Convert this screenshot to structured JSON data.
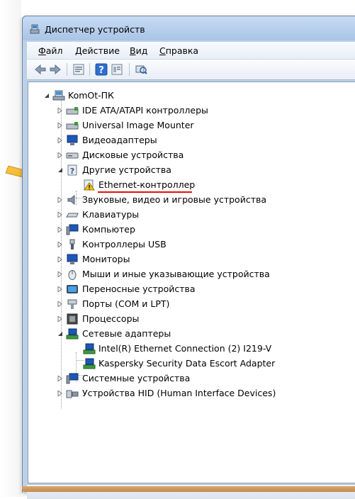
{
  "window": {
    "title": "Диспетчер устройств"
  },
  "menu": {
    "file": "Файл",
    "action": "Действие",
    "view": "Вид",
    "help": "Справка"
  },
  "toolbar": {
    "back": "back-icon",
    "forward": "forward-icon",
    "properties": "properties-icon",
    "help": "help-icon",
    "show": "show-icon",
    "scan": "scan-icon"
  },
  "tree": {
    "root": "KomOt-ПК",
    "items": [
      {
        "label": "IDE ATA/ATAPI контроллеры"
      },
      {
        "label": "Universal Image Mounter"
      },
      {
        "label": "Видеоадаптеры"
      },
      {
        "label": "Дисковые устройства"
      },
      {
        "label": "Другие устройства"
      },
      {
        "label": "Ethernet-контроллер"
      },
      {
        "label": "Звуковые, видео и игровые устройства"
      },
      {
        "label": "Клавиатуры"
      },
      {
        "label": "Компьютер"
      },
      {
        "label": "Контроллеры USB"
      },
      {
        "label": "Мониторы"
      },
      {
        "label": "Мыши и иные указывающие устройства"
      },
      {
        "label": "Переносные устройства"
      },
      {
        "label": "Порты (COM и LPT)"
      },
      {
        "label": "Процессоры"
      },
      {
        "label": "Сетевые адаптеры"
      },
      {
        "label": "Intel(R) Ethernet Connection (2) I219-V"
      },
      {
        "label": "Kaspersky Security Data Escort Adapter"
      },
      {
        "label": "Системные устройства"
      },
      {
        "label": "Устройства HID (Human Interface Devices)"
      }
    ]
  },
  "colors": {
    "accent_arrow": "#f0b12a",
    "underline": "#e01010"
  }
}
